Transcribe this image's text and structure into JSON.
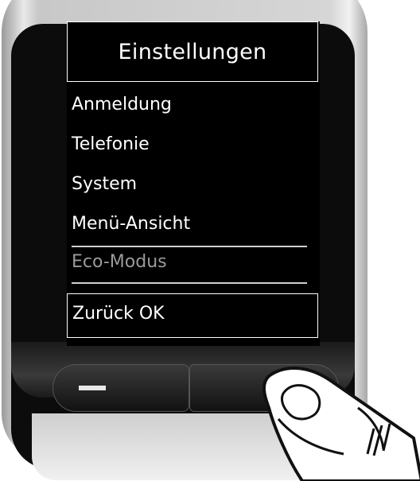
{
  "screen": {
    "title": "Einstellungen",
    "menu_items": [
      {
        "label": "Anmeldung",
        "state": "normal"
      },
      {
        "label": "Telefonie",
        "state": "normal"
      },
      {
        "label": "System",
        "state": "normal"
      },
      {
        "label": "Menü-Ansicht",
        "state": "normal"
      },
      {
        "label": "Eco-Modus",
        "state": "disabled"
      }
    ],
    "softkeys": "Zurück OK"
  },
  "icons": {
    "left_key": "minus-icon",
    "right_key_press": "finger-pressing-icon"
  },
  "colors": {
    "screen_bg": "#000000",
    "text": "#ffffff",
    "dim_text": "#9a9a9a"
  }
}
